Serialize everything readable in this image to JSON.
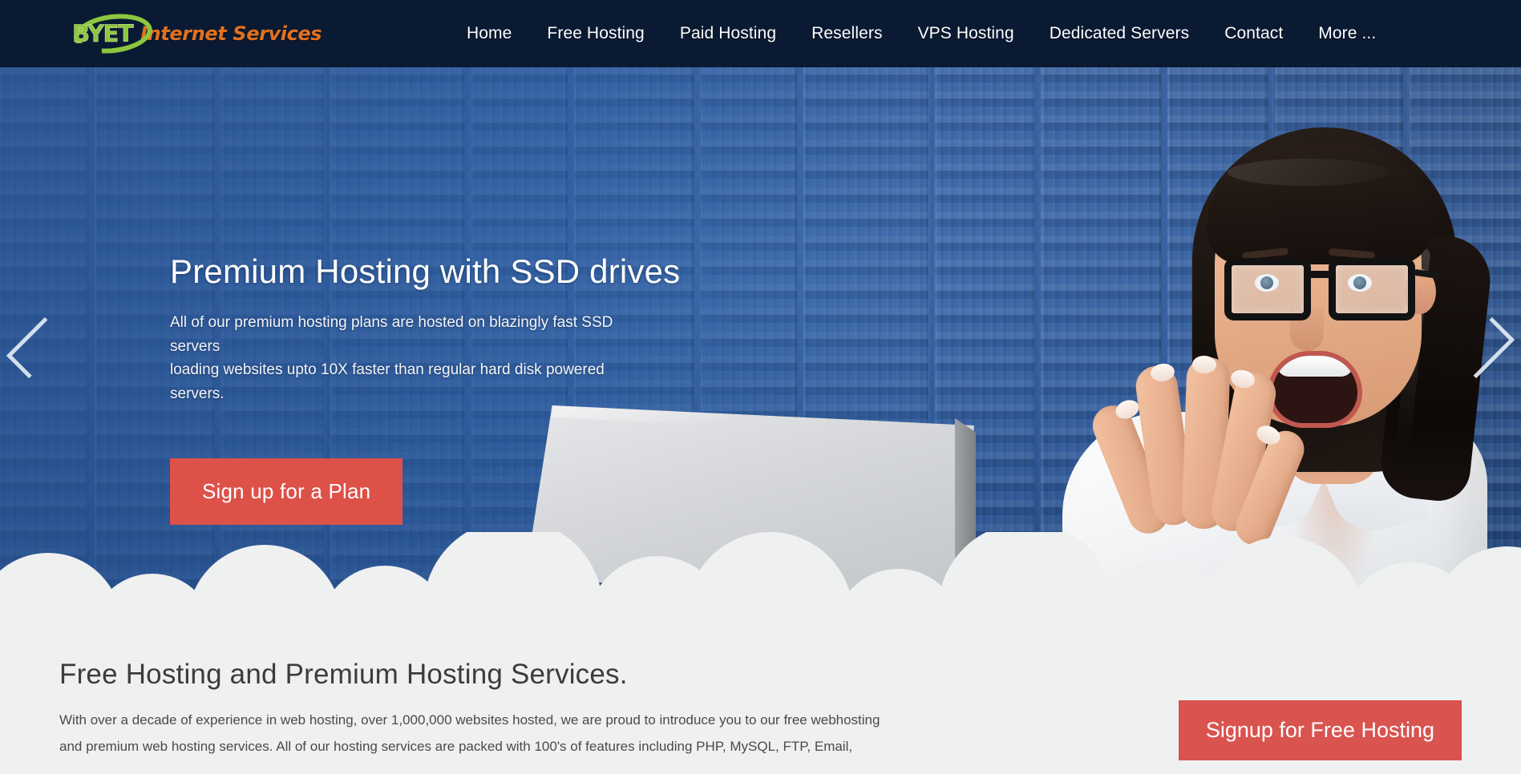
{
  "brand": {
    "logo_mark_text": "BYET",
    "logo_tagline": "Internet Services",
    "logo_green": "#8dc63f",
    "logo_orange": "#e2711d",
    "header_bg": "#0a1a33"
  },
  "nav": {
    "items": [
      {
        "label": "Home"
      },
      {
        "label": "Free Hosting"
      },
      {
        "label": "Paid Hosting"
      },
      {
        "label": "Resellers"
      },
      {
        "label": "VPS Hosting"
      },
      {
        "label": "Dedicated Servers"
      },
      {
        "label": "Contact"
      },
      {
        "label": "More ..."
      }
    ]
  },
  "hero": {
    "title": "Premium Hosting with SSD drives",
    "subtitle_line1": "All of our premium hosting plans are hosted on blazingly fast SSD servers",
    "subtitle_line2": "loading websites upto 10X faster than regular hard disk powered servers.",
    "cta_label": "Sign up for a Plan",
    "cta_color": "#dd5149",
    "prev_icon": "chevron-left-icon",
    "next_icon": "chevron-right-icon",
    "background_color": "#2f60a8"
  },
  "main": {
    "section_title": "Free Hosting and Premium Hosting Services.",
    "paragraph_line1": "With over a decade of experience in web hosting, over 1,000,000 websites hosted, we are proud to introduce you to our free webhosting",
    "paragraph_line2": "and premium web hosting services. All of our hosting services are packed with 100's of features including PHP, MySQL, FTP, Email,",
    "signup_label": "Signup for Free Hosting",
    "signup_color": "#d9534f",
    "background_color": "#eff0f0"
  }
}
